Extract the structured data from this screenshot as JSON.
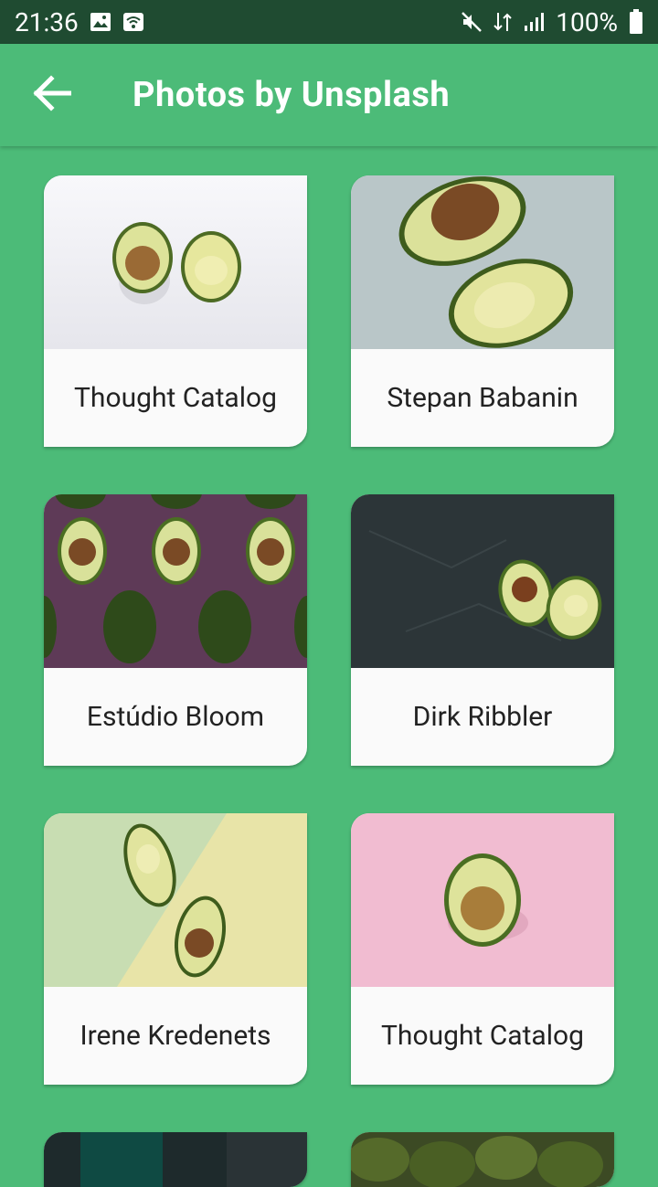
{
  "status_bar": {
    "time": "21:36",
    "battery": "100%",
    "icons": [
      "image-icon",
      "wifi-icon",
      "mute-icon",
      "data-icon",
      "signal-icon",
      "battery-icon"
    ]
  },
  "app_bar": {
    "title": "Photos by Unsplash",
    "back_icon": "arrow-left-icon"
  },
  "cards": [
    {
      "author": "Thought Catalog",
      "photo": "two avocado halves on white"
    },
    {
      "author": "Stepan Babanin",
      "photo": "avocado halves on grey"
    },
    {
      "author": "Estúdio Bloom",
      "photo": "avocado pattern on purple"
    },
    {
      "author": "Dirk Ribbler",
      "photo": "avocado halves on dark slate"
    },
    {
      "author": "Irene Kredenets",
      "photo": "avocado halves on green-yellow"
    },
    {
      "author": "Thought Catalog",
      "photo": "avocado half on pink"
    }
  ],
  "colors": {
    "primary": "#4CBB78",
    "status_bar": "#1F4B31",
    "card": "#FAFAFA"
  }
}
